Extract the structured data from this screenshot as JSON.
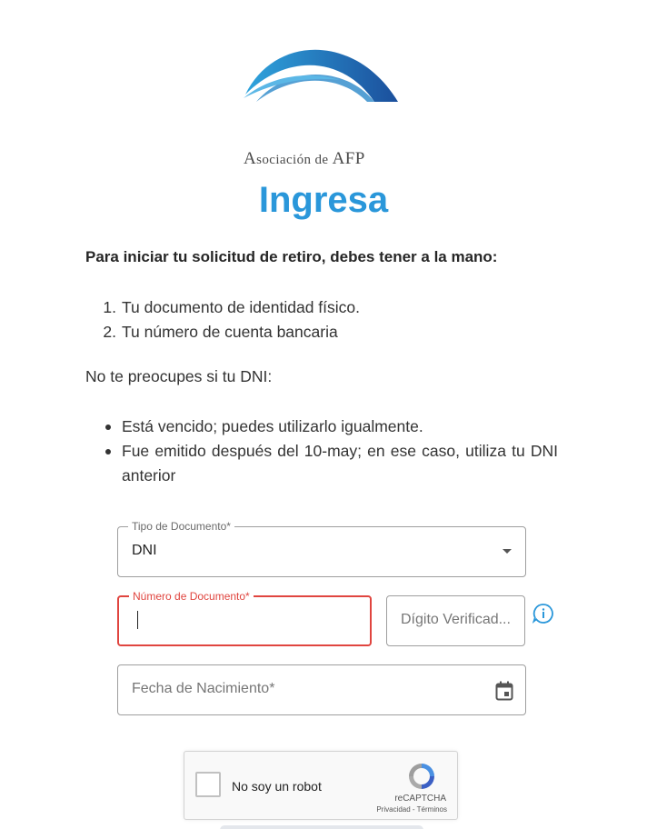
{
  "brand": {
    "logo_text_parts": [
      "A",
      "sociación de ",
      "AFP"
    ],
    "colors": {
      "arc_dark": "#1b4f9c",
      "arc_light": "#2fa4dd",
      "accent": "#2a97da",
      "error": "#e0453f"
    }
  },
  "page": {
    "title": "Ingresa",
    "intro": "Para iniciar tu solicitud de retiro, debes tener a la mano:",
    "requirements": [
      {
        "num": "1.",
        "text": "Tu documento de identidad físico."
      },
      {
        "num": "2.",
        "text": "Tu número de cuenta bancaria"
      }
    ],
    "dni_note": "No te preocupes si tu DNI:",
    "dni_cases": [
      "Está vencido; puedes utilizarlo igualmente.",
      "Fue emitido después del 10-may; en ese caso, utiliza tu DNI anterior"
    ]
  },
  "form": {
    "doc_type": {
      "label": "Tipo de Documento*",
      "value": "DNI"
    },
    "doc_number": {
      "label": "Número de Documento*",
      "value": ""
    },
    "check_digit": {
      "placeholder": "Dígito Verificad..."
    },
    "birth_date": {
      "placeholder": "Fecha de Nacimiento*"
    }
  },
  "recaptcha": {
    "label": "No soy un robot",
    "brand": "reCAPTCHA",
    "links": "Privacidad - Términos"
  },
  "icons": [
    "logo-arc-icon",
    "dropdown-arrow-icon",
    "info-icon",
    "calendar-icon",
    "recaptcha-logo-icon"
  ]
}
